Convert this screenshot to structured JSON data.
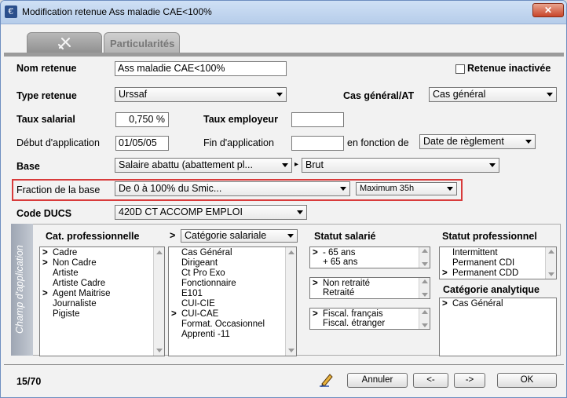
{
  "window": {
    "title": "Modification retenue Ass maladie CAE<100%",
    "close_symbol": "✕"
  },
  "tabs": {
    "icon_tab": "tool-icon",
    "particularites": "Particularités"
  },
  "form": {
    "nom_retenue_label": "Nom retenue",
    "nom_retenue_value": "Ass maladie CAE<100%",
    "retenue_inactivee_label": "Retenue inactivée",
    "type_retenue_label": "Type retenue",
    "type_retenue_value": "Urssaf",
    "cas_general_label": "Cas général/AT",
    "cas_general_value": "Cas général",
    "taux_salarial_label": "Taux salarial",
    "taux_salarial_value": "0,750 %",
    "taux_employeur_label": "Taux employeur",
    "taux_employeur_value": "",
    "debut_label": "Début d'application",
    "debut_value": "01/05/05",
    "fin_label": "Fin d'application",
    "fin_value": "",
    "en_fonction_label": "en fonction de",
    "en_fonction_value": "Date de règlement",
    "base_label": "Base",
    "base_value": "Salaire abattu (abattement pl...",
    "base_sep": "▸",
    "base_type_value": "Brut",
    "fraction_label": "Fraction de la base",
    "fraction_value": "De 0 à 100% du Smic...",
    "fraction_max_value": "Maximum 35h",
    "code_ducs_label": "Code DUCS",
    "code_ducs_value": "420D   CT ACCOMP EMPLOI"
  },
  "champ": {
    "side_label": "Champ d'application",
    "cat_pro_label": "Cat. professionnelle",
    "categorie_sal_value": "Catégorie salariale",
    "categorie_sal_prefix": ">",
    "statut_salarie_label": "Statut salarié",
    "statut_pro_label": "Statut professionnel",
    "categorie_analytique_label": "Catégorie analytique",
    "cat_pro_items": [
      {
        "mark": ">",
        "text": "Cadre"
      },
      {
        "mark": ">",
        "text": "Non Cadre"
      },
      {
        "mark": "",
        "text": "Artiste"
      },
      {
        "mark": "",
        "text": "Artiste Cadre"
      },
      {
        "mark": ">",
        "text": "Agent Maitrise"
      },
      {
        "mark": "",
        "text": "Journaliste"
      },
      {
        "mark": "",
        "text": "Pigiste"
      }
    ],
    "categorie_items": [
      {
        "mark": "",
        "text": "Cas Général"
      },
      {
        "mark": "",
        "text": "Dirigeant"
      },
      {
        "mark": "",
        "text": "Ct Pro Exo"
      },
      {
        "mark": "",
        "text": "Fonctionnaire"
      },
      {
        "mark": "",
        "text": "E101"
      },
      {
        "mark": "",
        "text": "CUI-CIE"
      },
      {
        "mark": ">",
        "text": "CUI-CAE"
      },
      {
        "mark": "",
        "text": "Format. Occasionnel"
      },
      {
        "mark": "",
        "text": "Apprenti -11"
      }
    ],
    "age_items": [
      {
        "mark": ">",
        "text": "- 65 ans"
      },
      {
        "mark": "",
        "text": "+ 65 ans"
      }
    ],
    "retraite_items": [
      {
        "mark": ">",
        "text": "Non retraité"
      },
      {
        "mark": "",
        "text": "Retraité"
      }
    ],
    "fiscal_items": [
      {
        "mark": ">",
        "text": "Fiscal. français"
      },
      {
        "mark": "",
        "text": "Fiscal. étranger"
      }
    ],
    "statut_pro_items": [
      {
        "mark": "",
        "text": "Intermittent"
      },
      {
        "mark": "",
        "text": "Permanent CDI"
      },
      {
        "mark": ">",
        "text": "Permanent CDD"
      }
    ],
    "analytique_items": [
      {
        "mark": ">",
        "text": "Cas Général"
      }
    ]
  },
  "footer": {
    "page_counter": "15/70",
    "edit_icon": "pencil-icon",
    "annuler_label": "Annuler",
    "prev_label": "<-",
    "next_label": "->",
    "ok_label": "OK"
  }
}
